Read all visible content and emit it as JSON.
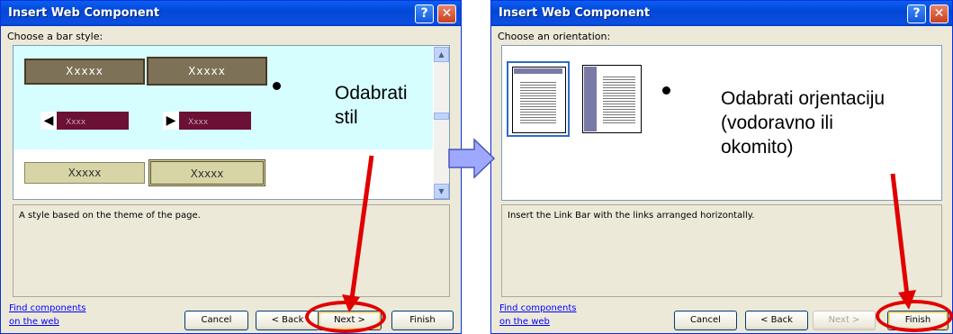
{
  "left_dialog": {
    "title": "Insert Web Component",
    "help_label": "?",
    "close_label": "✕",
    "prompt": "Choose a bar style:",
    "styles": {
      "sample_1": "Xxxxx",
      "sample_2": "Xxxxx",
      "link_1": "Xxxx",
      "link_2": "Xxxx",
      "sample_3": "Xxxxx",
      "sample_4": "Xxxxx"
    },
    "description": "A style based on the theme of the page.",
    "find_link_line1": "Find components",
    "find_link_line2": "on the web",
    "buttons": {
      "cancel": "Cancel",
      "back": "< Back",
      "next": "Next >",
      "finish": "Finish"
    }
  },
  "right_dialog": {
    "title": "Insert Web Component",
    "help_label": "?",
    "close_label": "✕",
    "prompt": "Choose an orientation:",
    "description": "Insert the Link Bar with the links arranged horizontally.",
    "find_link_line1": "Find components",
    "find_link_line2": "on the web",
    "buttons": {
      "cancel": "Cancel",
      "back": "< Back",
      "next": "Next >",
      "finish": "Finish"
    }
  },
  "annotations": {
    "left_line1": "Odabrati",
    "left_line2": "stil",
    "right_line1": "Odabrati orjentaciju",
    "right_line2": "(vodoravno ili",
    "right_line3": "okomito)"
  },
  "colors": {
    "arrow": "#e00000",
    "connector_fill": "#9ea8ff"
  }
}
